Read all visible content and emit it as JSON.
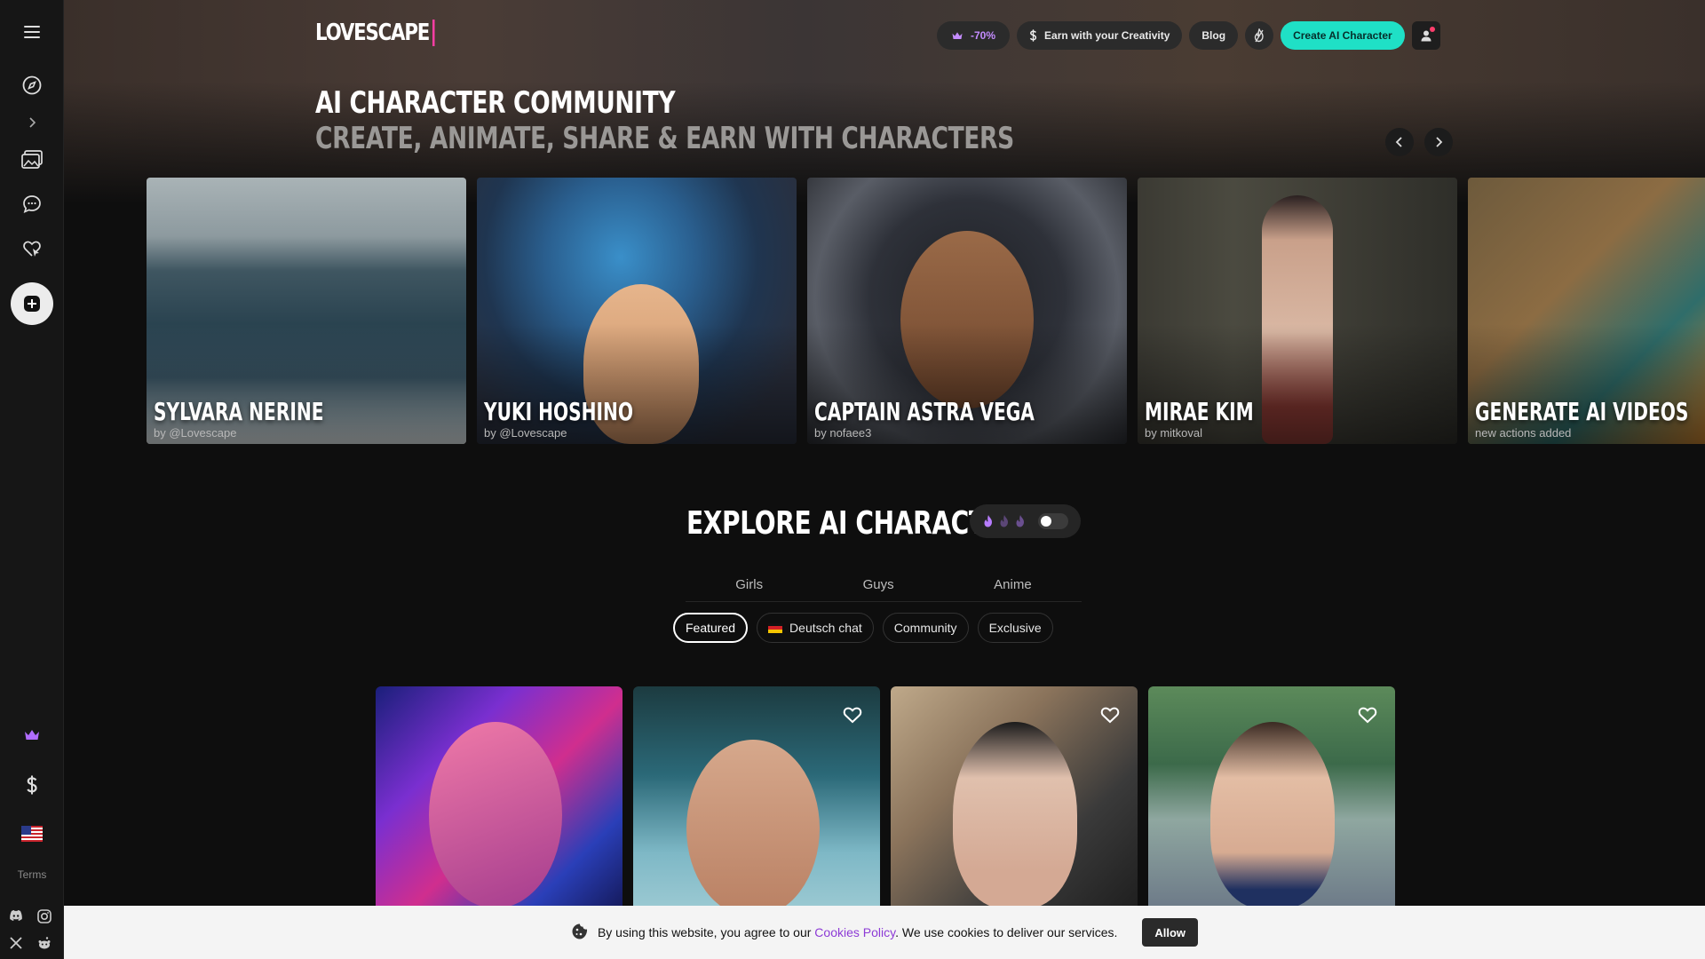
{
  "brand": {
    "logo": "LOVESCAPE"
  },
  "sidebar": {
    "terms_label": "Terms",
    "icons": [
      "menu-icon",
      "compass-icon",
      "chevron-right-icon",
      "gallery-icon",
      "chat-icon",
      "heart-cursor-icon",
      "create-icon",
      "crown-icon",
      "dollar-icon",
      "us-flag-icon",
      "discord-icon",
      "instagram-icon",
      "x-icon",
      "reddit-icon"
    ]
  },
  "header": {
    "discount_label": "-70%",
    "earn_label": "Earn with your Creativity",
    "blog_label": "Blog",
    "create_label": "Create AI Character"
  },
  "hero": {
    "title": "AI CHARACTER COMMUNITY",
    "subtitle": "CREATE, ANIMATE, SHARE & EARN WITH CHARACTERS"
  },
  "carousel": [
    {
      "name": "SYLVARA NERINE",
      "by": "by @Lovescape"
    },
    {
      "name": "YUKI HOSHINO",
      "by": "by @Lovescape"
    },
    {
      "name": "CAPTAIN ASTRA VEGA",
      "by": "by nofaee3"
    },
    {
      "name": "MIRAE KIM",
      "by": "by mitkoval"
    },
    {
      "name": "GENERATE AI VIDEOS",
      "by": "new actions added"
    }
  ],
  "explore": {
    "title": "EXPLORE AI CHARACTERS",
    "tabs": [
      "Girls",
      "Guys",
      "Anime"
    ],
    "chips": [
      "Featured",
      "Deutsch chat",
      "Community",
      "Exclusive"
    ],
    "active_chip": "Featured",
    "toggle_on": false
  },
  "cookie": {
    "text_before": "By using this website, you agree to our",
    "link": "Cookies Policy",
    "text_after": ". We use cookies to deliver our services.",
    "allow_label": "Allow"
  },
  "colors": {
    "accent": "#1fe0c6",
    "discount": "#c48cff",
    "link": "#8d3bd6"
  }
}
